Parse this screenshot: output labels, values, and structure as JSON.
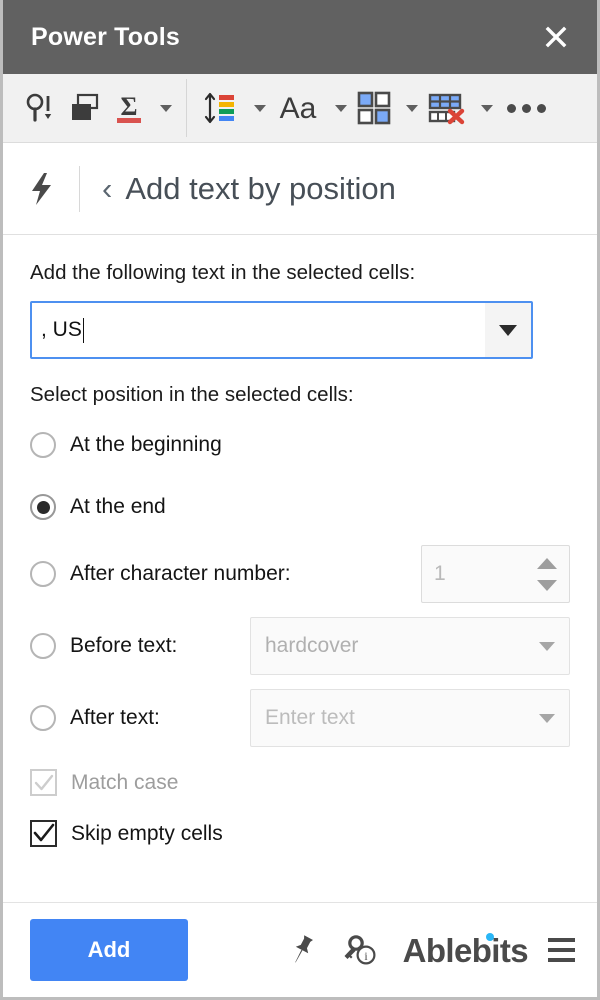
{
  "window": {
    "title": "Power Tools",
    "close_label": "✕"
  },
  "toolbar": {
    "items": [
      {
        "name": "find-and-replace",
        "icon": "magnifier-exclamation-icon"
      },
      {
        "name": "merge-sheets",
        "icon": "merge-sheets-icon"
      },
      {
        "name": "formulas",
        "icon": "sigma-icon"
      },
      {
        "name": "sort-and-filter",
        "icon": "sort-color-icon"
      },
      {
        "name": "text",
        "icon": "text-Aa-icon"
      },
      {
        "name": "split",
        "icon": "split-quadrant-icon"
      },
      {
        "name": "clear-remove",
        "icon": "table-remove-icon"
      },
      {
        "name": "more-tools",
        "icon": "ellipsis-icon"
      }
    ]
  },
  "subheader": {
    "tool_icon": "lightning-bolt-icon",
    "back_label": "‹",
    "title": "Add text by position"
  },
  "main": {
    "text_label": "Add the following text in the selected cells:",
    "text_value": ", US",
    "position_label": "Select position in the selected cells:",
    "options": [
      {
        "id": "beginning",
        "label": "At the beginning",
        "selected": false
      },
      {
        "id": "end",
        "label": "At the end",
        "selected": true
      },
      {
        "id": "after-char",
        "label": "After character number:",
        "selected": false,
        "control_value": "1"
      },
      {
        "id": "before-text",
        "label": "Before text:",
        "selected": false,
        "control_value": "hardcover"
      },
      {
        "id": "after-text",
        "label": "After text:",
        "selected": false,
        "control_placeholder": "Enter text"
      }
    ],
    "checkboxes": [
      {
        "id": "match-case",
        "label": "Match case",
        "checked": true,
        "disabled": true
      },
      {
        "id": "skip-empty",
        "label": "Skip empty cells",
        "checked": true,
        "disabled": false
      }
    ]
  },
  "footer": {
    "add_label": "Add",
    "pin_icon": "pushpin-icon",
    "info_icon": "key-info-icon",
    "brand": "Ablebits",
    "menu_icon": "hamburger-icon"
  },
  "colors": {
    "titlebar": "#616161",
    "accent": "#4285f4",
    "focus_border": "#4d90f0",
    "brand_dot": "#29b6f6"
  }
}
